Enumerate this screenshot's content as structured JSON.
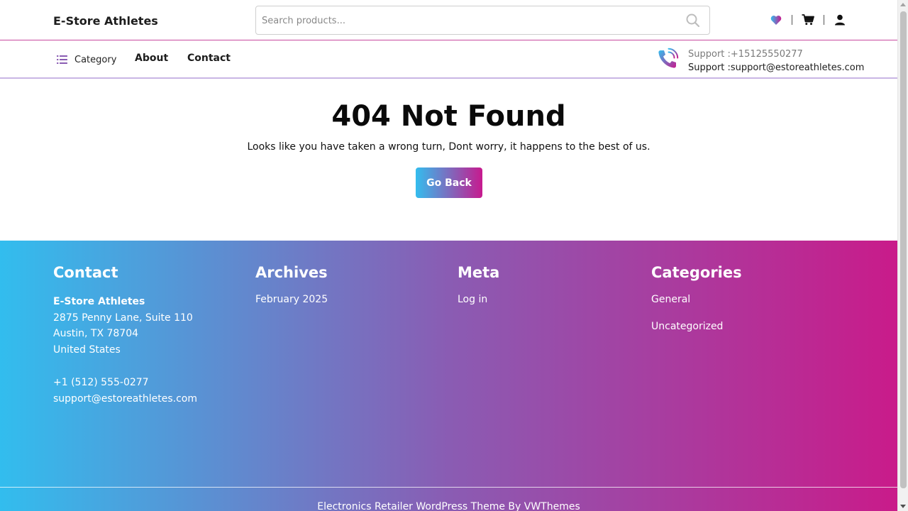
{
  "header": {
    "site_title": "E-Store Athletes",
    "search_placeholder": "Search products...",
    "icons": [
      "heart-icon",
      "cart-icon",
      "user-icon"
    ]
  },
  "nav": {
    "category_label": "Category",
    "links": [
      "About",
      "Contact"
    ],
    "support_phone": "Support :+15125550277",
    "support_email": "Support :support@estoreathletes.com"
  },
  "main": {
    "title": "404 Not Found",
    "description": "Looks like you have taken a wrong turn, Dont worry, it happens to the best of us.",
    "button_label": "Go Back"
  },
  "footer": {
    "contact": {
      "heading": "Contact",
      "name": "E-Store Athletes",
      "address1": "2875 Penny Lane, Suite 110",
      "address2": "Austin, TX 78704",
      "country": "United States",
      "phone": "+1 (512) 555-0277",
      "email": "support@estoreathletes.com"
    },
    "archives": {
      "heading": "Archives",
      "items": [
        "February 2025"
      ]
    },
    "meta": {
      "heading": "Meta",
      "items": [
        "Log in"
      ]
    },
    "categories": {
      "heading": "Categories",
      "items": [
        "General",
        "Uncategorized"
      ]
    },
    "credit": "Electronics Retailer WordPress Theme By VWThemes"
  },
  "colors": {
    "gradient_start": "#33bdee",
    "gradient_end": "#c71a8e",
    "header_border": "#c84aa0"
  }
}
